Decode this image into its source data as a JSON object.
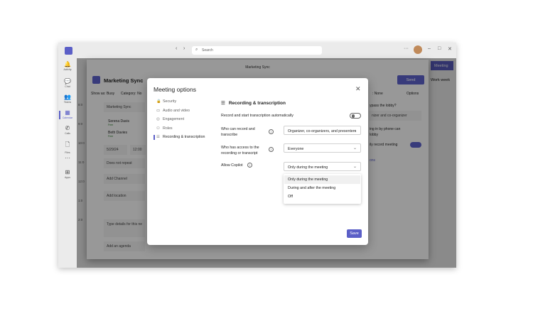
{
  "titlebar": {
    "search_placeholder": "Search",
    "more": "···",
    "minimize": "–",
    "maximize": "□",
    "close": "✕"
  },
  "rail": [
    {
      "label": "Activity",
      "icon": "bell-icon",
      "glyph": "🔔"
    },
    {
      "label": "Chat",
      "icon": "chat-icon",
      "glyph": "💬"
    },
    {
      "label": "Teams",
      "icon": "teams-icon",
      "glyph": "👥"
    },
    {
      "label": "Calendar",
      "icon": "calendar-icon",
      "glyph": "▦"
    },
    {
      "label": "Calls",
      "icon": "phone-icon",
      "glyph": "✆"
    },
    {
      "label": "Files",
      "icon": "file-icon",
      "glyph": "🗋"
    },
    {
      "label": "",
      "icon": "more-icon",
      "glyph": "···"
    },
    {
      "label": "Apps",
      "icon": "apps-icon",
      "glyph": "⊞"
    }
  ],
  "background": {
    "meeting_button": "Meeting",
    "view": "Work week",
    "times": [
      "8:0",
      "9:0",
      "10:0",
      "11:0",
      "12:0",
      "1:0",
      "2:0"
    ]
  },
  "popup": {
    "window_title": "Marketing Sync",
    "title": "Marketing Sync",
    "send": "Send",
    "show_as": "Show as: Busy",
    "category": "Category: No",
    "sensitivity": ": None",
    "options": "Options",
    "title_field": "Marketing Sync",
    "attendees": [
      {
        "name": "Serena Davis",
        "status": "Free"
      },
      {
        "name": "Beth Davies",
        "status": "Free"
      }
    ],
    "date": "5/29/24",
    "time": "12:00",
    "repeat": "Does not repeat",
    "channel": "Add Channel",
    "location": "Add location",
    "details": "Type details for this ne",
    "agenda": "Add an agenda",
    "lobby": "ypass the lobby?",
    "lobby_value": "nizer and co-organizer",
    "phone": "ing in by phone can",
    "phone2": "lobby",
    "auto_record": "ily record meeting",
    "more_options": "ons"
  },
  "dialog": {
    "title": "Meeting options",
    "nav": [
      {
        "label": "Security",
        "glyph": "🔒",
        "icon": "lock-icon"
      },
      {
        "label": "Audio and video",
        "glyph": "▭",
        "icon": "video-icon"
      },
      {
        "label": "Engagement",
        "glyph": "◎",
        "icon": "engagement-icon"
      },
      {
        "label": "Roles",
        "glyph": "⚇",
        "icon": "person-icon"
      },
      {
        "label": "Recording & transcription",
        "glyph": "☰",
        "icon": "list-icon"
      }
    ],
    "section_title": "Recording & transcription",
    "auto_record_label": "Record and start transcription automatically",
    "auto_record_on": false,
    "who_record_label": "Who can record and transcribe",
    "who_record_value": "Organizer, co-organizers, and presenters",
    "who_access_label": "Who has access to the recording or transcript",
    "who_access_value": "Everyone",
    "copilot_label": "Allow Copilot",
    "copilot_value": "Only during the meeting",
    "copilot_options": [
      "Only during the meeting",
      "During and after the meeting",
      "Off"
    ],
    "save": "Save"
  },
  "colors": {
    "accent": "#5b5fc7"
  }
}
